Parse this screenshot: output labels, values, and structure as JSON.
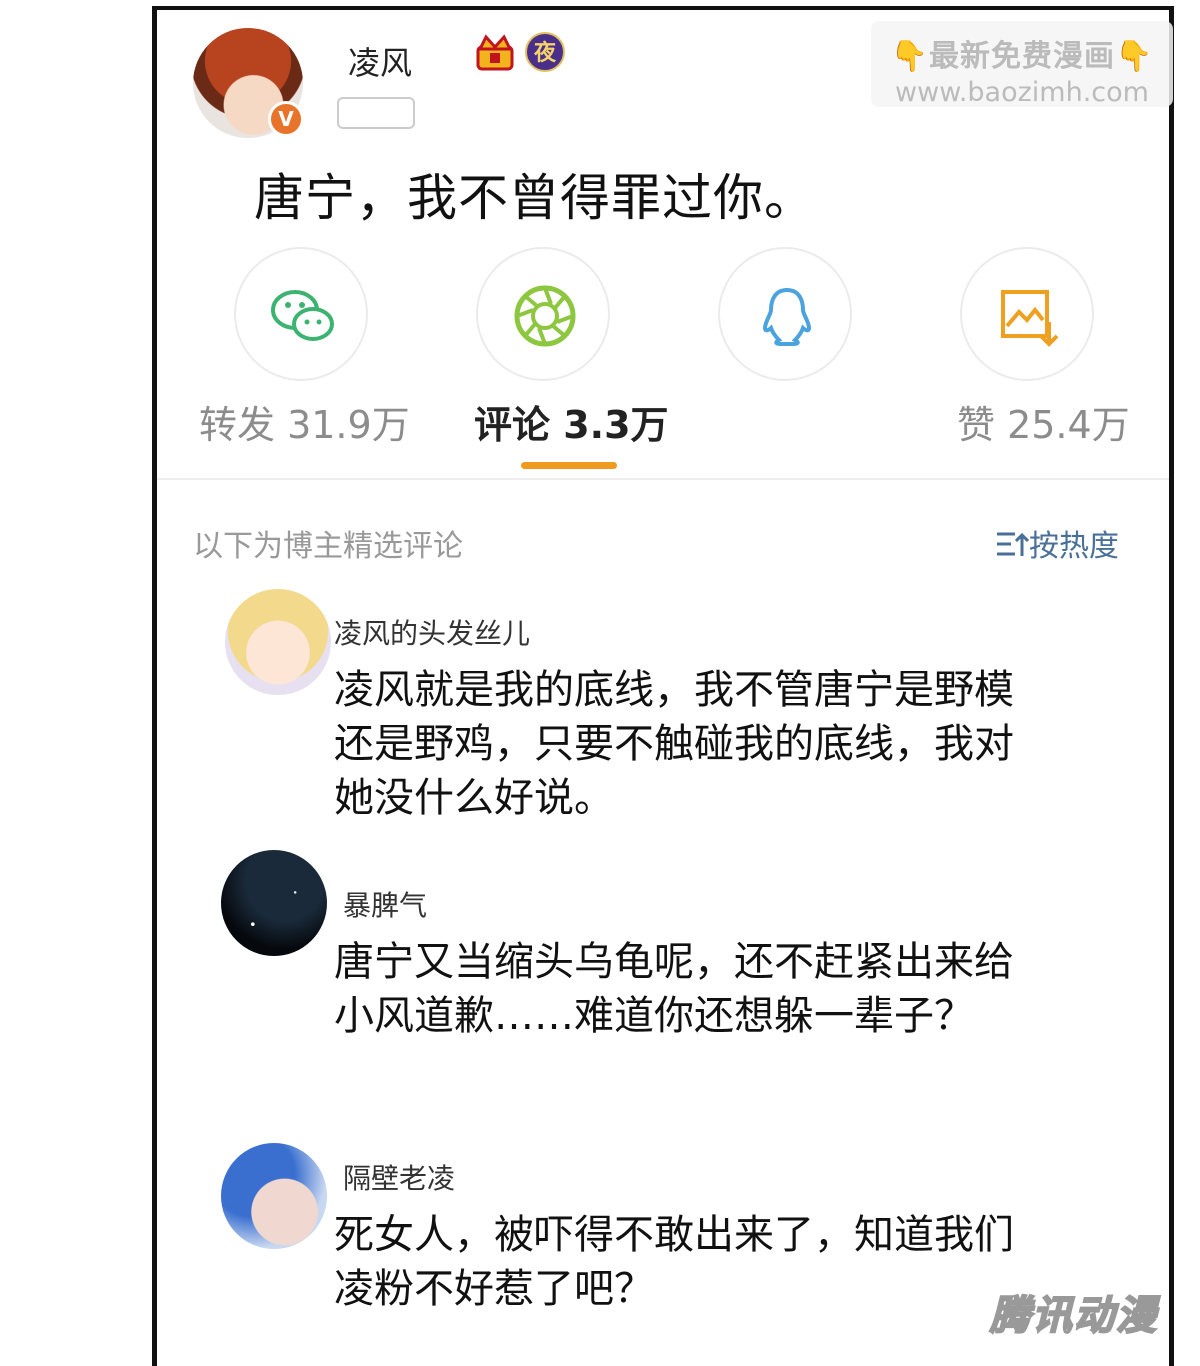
{
  "post": {
    "author": "凌风",
    "night_badge": "夜",
    "vip_badge": "V",
    "text": "唐宁，我不曾得罪过你。"
  },
  "watermark": {
    "line1": "👇最新免费漫画👇",
    "line2": "www.baozimh.com"
  },
  "share_buttons": [
    "wechat-icon",
    "moments-icon",
    "qq-icon",
    "save-image-icon"
  ],
  "stats": {
    "repost": "转发 31.9万",
    "comments": "评论 3.3万",
    "likes": "赞 25.4万"
  },
  "comments_header": {
    "title": "以下为博主精选评论",
    "sort_label": "按热度"
  },
  "comments": [
    {
      "name": "凌风的头发丝儿",
      "lines": [
        "凌风就是我的底线，我不管唐宁是野模",
        "还是野鸡，只要不触碰我的底线，我对",
        "她没什么好说。"
      ]
    },
    {
      "name": "暴脾气",
      "lines": [
        "唐宁又当缩头乌龟呢，还不赶紧出来给",
        "小风道歉……难道你还想躲一辈子？"
      ]
    },
    {
      "name": "隔壁老凌",
      "lines": [
        "死女人，被吓得不敢出来了，知道我们",
        "凌粉不好惹了吧？"
      ]
    }
  ],
  "logo": "腾讯动漫",
  "colors": {
    "accent": "#f09a20",
    "wechat": "#3cb371",
    "moments": "#8dc63f",
    "qq": "#4aa3df",
    "save": "#f0a020",
    "sort": "#4a6f99"
  }
}
